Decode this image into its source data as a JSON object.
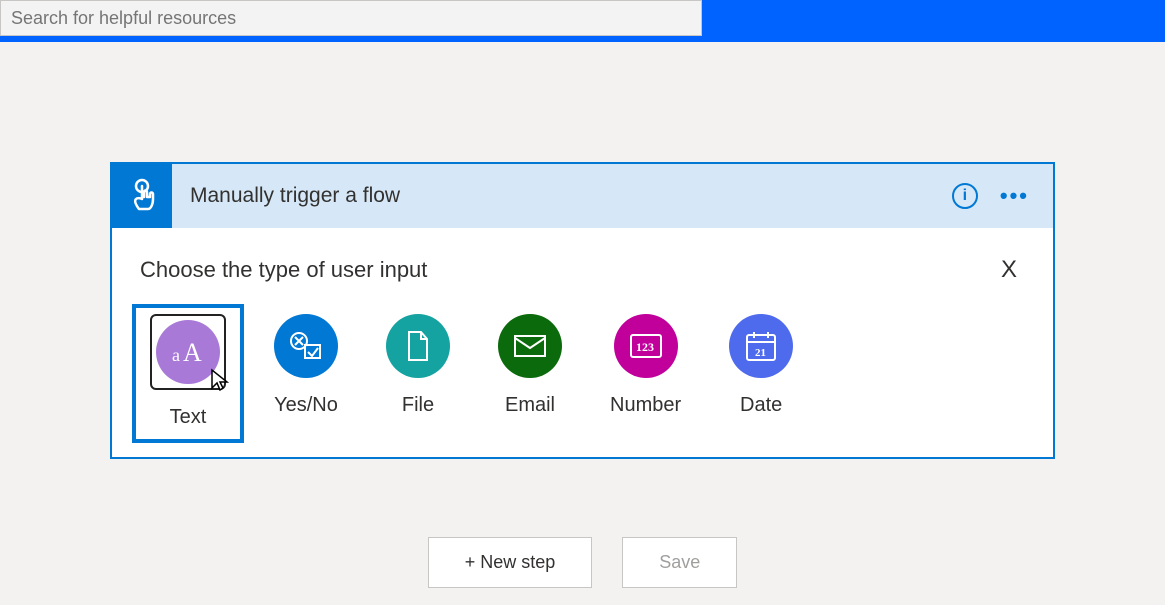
{
  "search": {
    "placeholder": "Search for helpful resources"
  },
  "trigger": {
    "title": "Manually trigger a flow",
    "info_symbol": "i",
    "body_title": "Choose the type of user input",
    "close_symbol": "X",
    "types": {
      "text": {
        "label": "Text",
        "color": "#a979d8"
      },
      "yesno": {
        "label": "Yes/No",
        "color": "#0078d4"
      },
      "file": {
        "label": "File",
        "color": "#14a3a1"
      },
      "email": {
        "label": "Email",
        "color": "#0b6a0b"
      },
      "number": {
        "label": "Number",
        "color": "#c1009c"
      },
      "date": {
        "label": "Date",
        "color": "#4f6bed"
      }
    }
  },
  "actions": {
    "new_step": "+ New step",
    "save": "Save"
  }
}
